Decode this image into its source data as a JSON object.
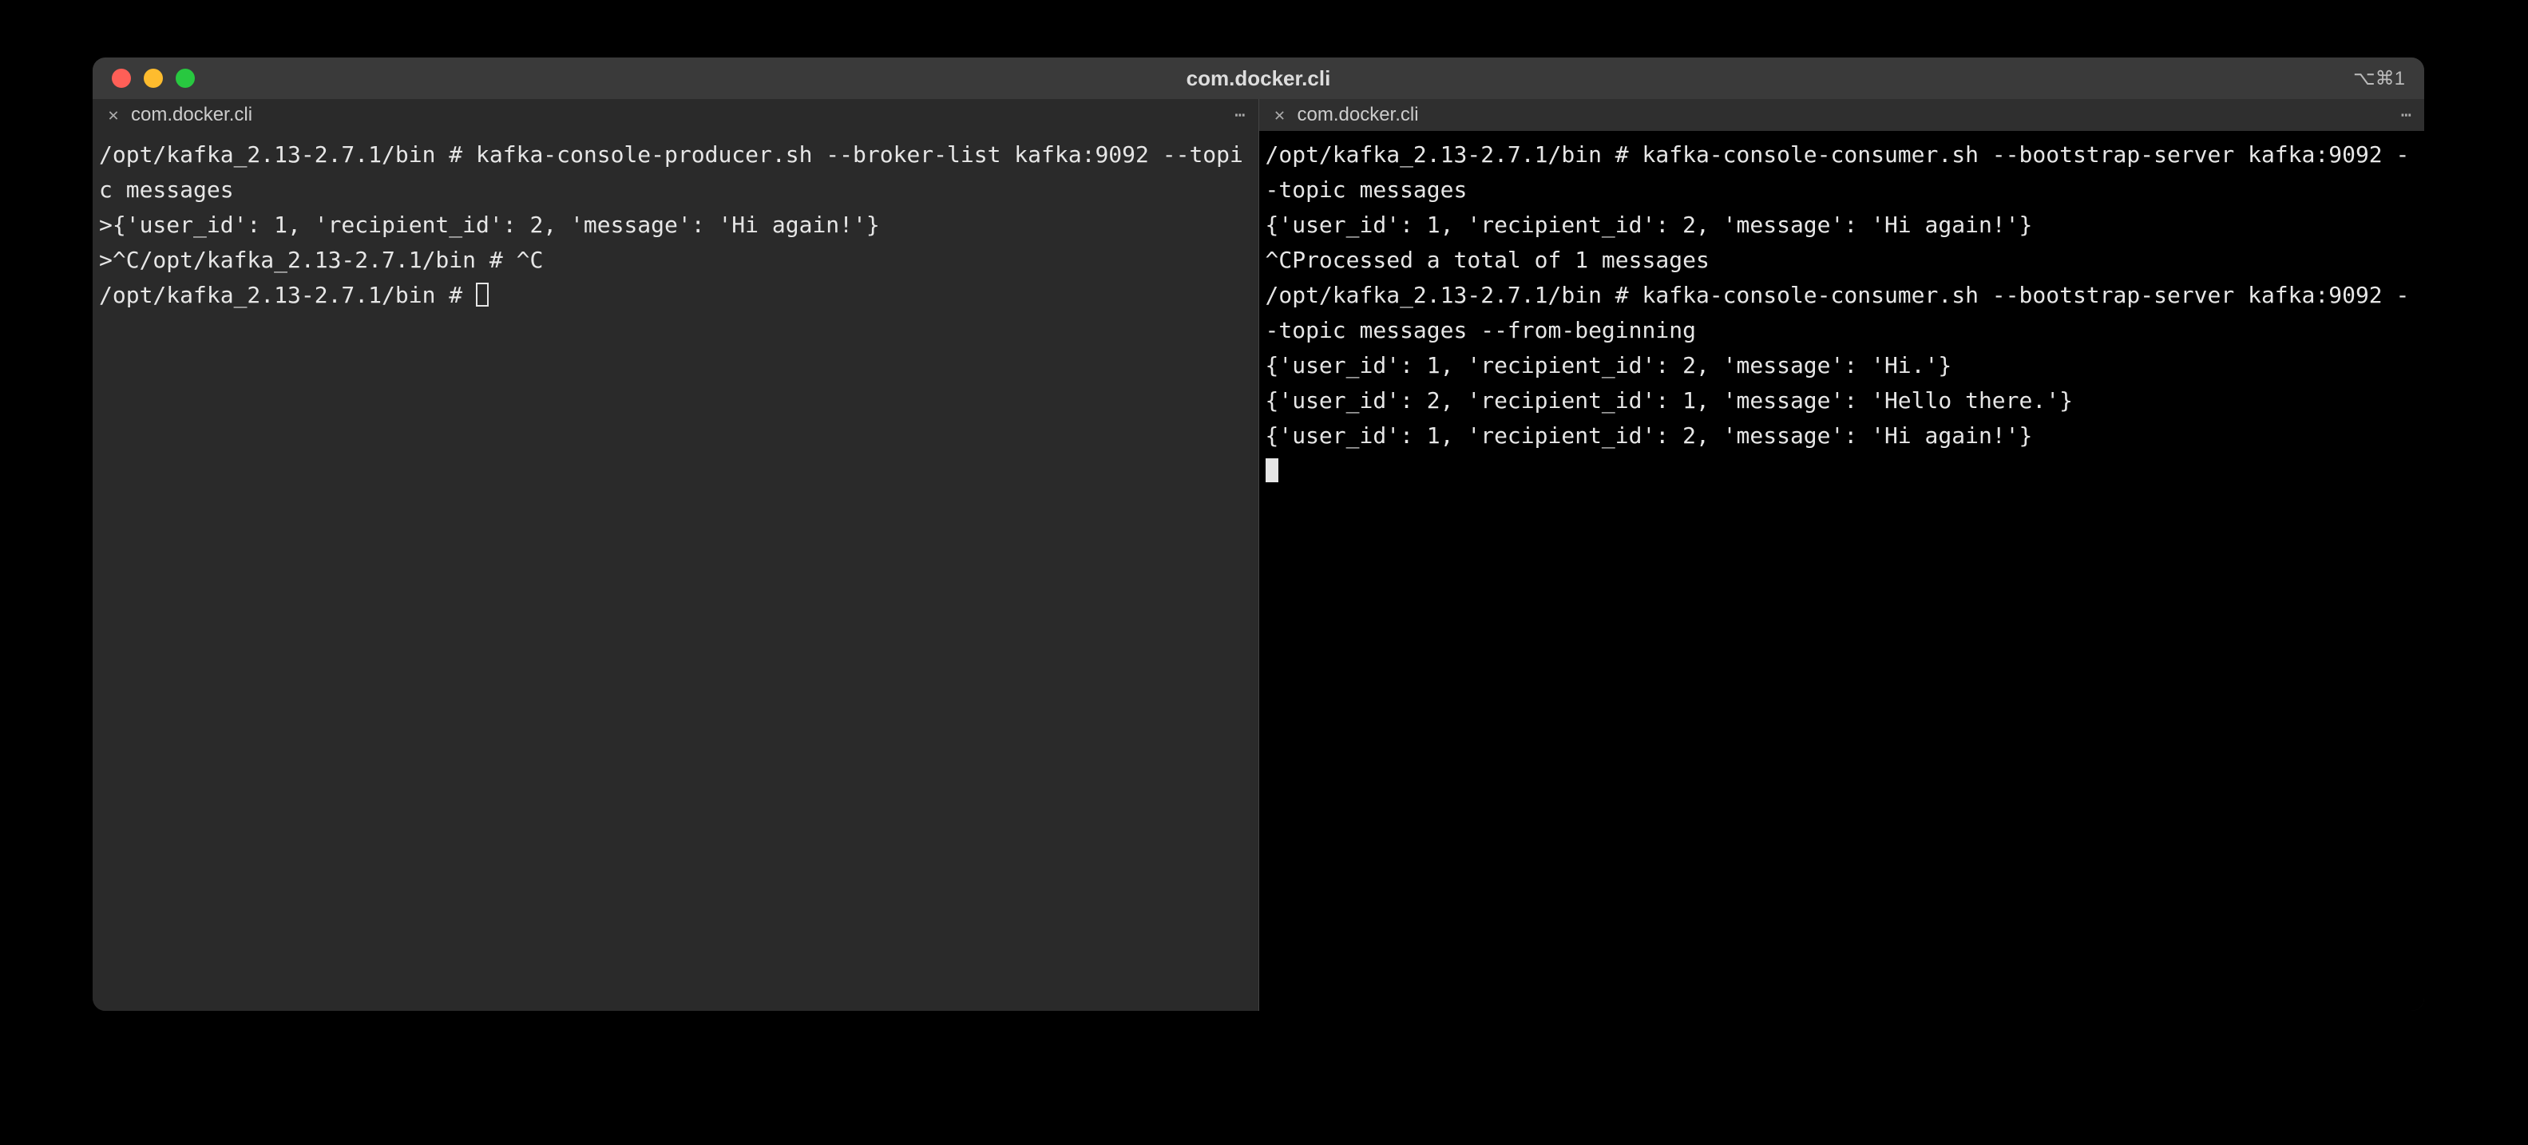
{
  "window": {
    "title": "com.docker.cli",
    "shortcut_hint": "⌥⌘1"
  },
  "left_pane": {
    "tab_label": "com.docker.cli",
    "lines": [
      "/opt/kafka_2.13-2.7.1/bin # kafka-console-producer.sh --broker-list kafka:9092 --topic messages",
      ">{'user_id': 1, 'recipient_id': 2, 'message': 'Hi again!'}",
      ">^C/opt/kafka_2.13-2.7.1/bin # ^C",
      "/opt/kafka_2.13-2.7.1/bin # "
    ]
  },
  "right_pane": {
    "tab_label": "com.docker.cli",
    "lines": [
      "/opt/kafka_2.13-2.7.1/bin # kafka-console-consumer.sh --bootstrap-server kafka:9092 --topic messages",
      "{'user_id': 1, 'recipient_id': 2, 'message': 'Hi again!'}",
      "^CProcessed a total of 1 messages",
      "/opt/kafka_2.13-2.7.1/bin # kafka-console-consumer.sh --bootstrap-server kafka:9092 --topic messages --from-beginning",
      "{'user_id': 1, 'recipient_id': 2, 'message': 'Hi.'}",
      "{'user_id': 2, 'recipient_id': 1, 'message': 'Hello there.'}",
      "{'user_id': 1, 'recipient_id': 2, 'message': 'Hi again!'}"
    ]
  }
}
